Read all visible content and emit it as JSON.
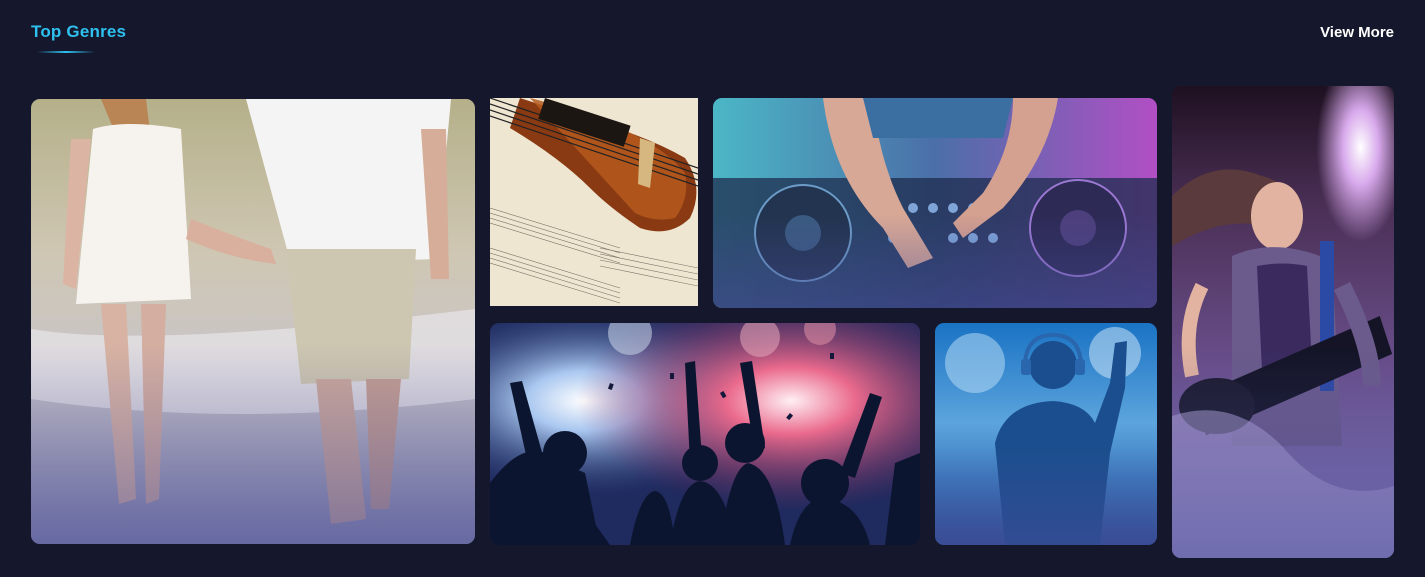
{
  "header": {
    "title": "Top Genres",
    "view_more_label": "View More"
  },
  "colors": {
    "background": "#15182c",
    "accent": "#2ec0ee",
    "text": "#ffffff"
  },
  "genres": [
    {
      "name": "romance-couple-image"
    },
    {
      "name": "classical-violin-image"
    },
    {
      "name": "dj-mixer-image"
    },
    {
      "name": "party-crowd-image"
    },
    {
      "name": "headphones-dj-silhouette-image"
    },
    {
      "name": "rock-guitarist-image"
    }
  ]
}
